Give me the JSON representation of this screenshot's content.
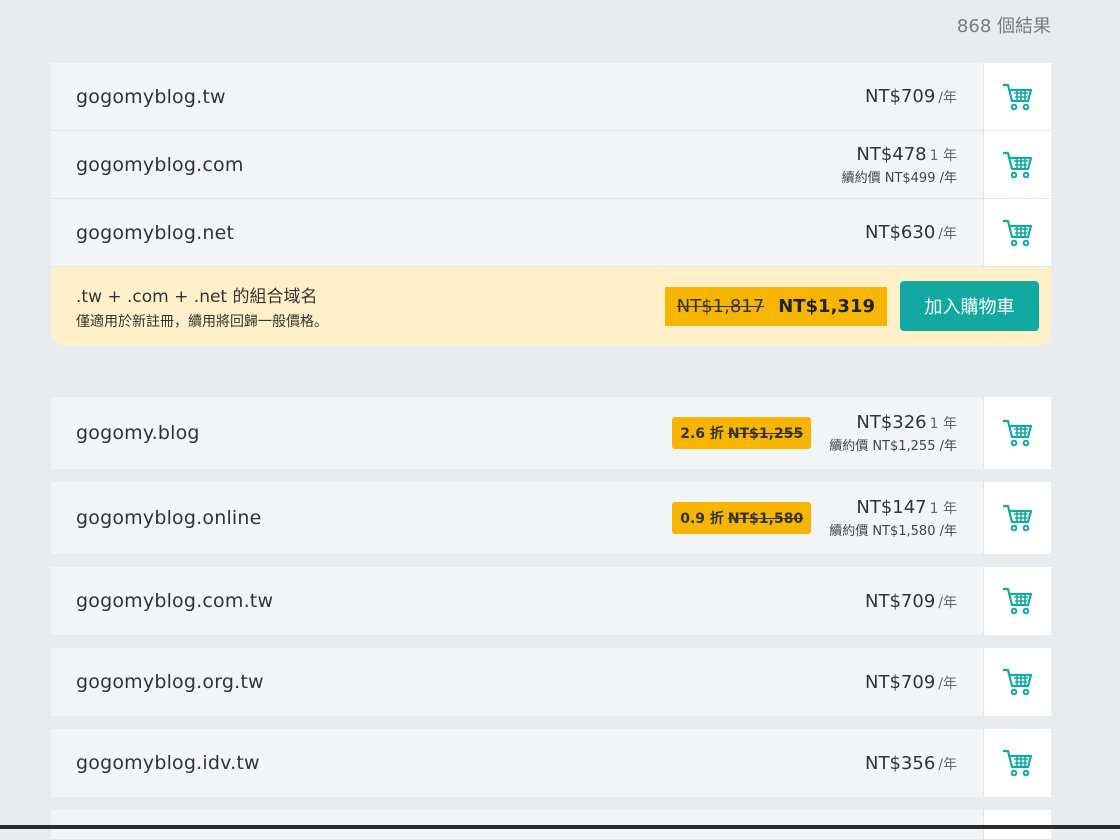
{
  "results_count": "868 個結果",
  "colors": {
    "accent": "#13a9a2",
    "badge": "#f7b500",
    "combo_bg": "#fff0c9"
  },
  "cart_icon": "shopping-cart-icon",
  "group1": [
    {
      "domain": "gogomyblog.tw",
      "price": "NT$709",
      "unit": "/年"
    },
    {
      "domain": "gogomyblog.com",
      "price": "NT$478",
      "unit": "1 年",
      "renew": "續約價 NT$499 /年"
    },
    {
      "domain": "gogomyblog.net",
      "price": "NT$630",
      "unit": "/年"
    }
  ],
  "combo": {
    "title": ".tw + .com + .net 的組合域名",
    "note": "僅適用於新註冊，續用將回歸一般價格。",
    "old_price": "NT$1,817",
    "new_price": "NT$1,319",
    "button": "加入購物車"
  },
  "group2": [
    {
      "domain": "gogomy.blog",
      "badge_discount": "2.6 折",
      "badge_old": "NT$1,255",
      "price": "NT$326",
      "unit": "1 年",
      "renew": "續約價 NT$1,255 /年"
    },
    {
      "domain": "gogomyblog.online",
      "badge_discount": "0.9 折",
      "badge_old": "NT$1,580",
      "price": "NT$147",
      "unit": "1 年",
      "renew": "續約價 NT$1,580 /年"
    },
    {
      "domain": "gogomyblog.com.tw",
      "price": "NT$709",
      "unit": "/年"
    },
    {
      "domain": "gogomyblog.org.tw",
      "price": "NT$709",
      "unit": "/年"
    },
    {
      "domain": "gogomyblog.idv.tw",
      "price": "NT$356",
      "unit": "/年"
    }
  ]
}
